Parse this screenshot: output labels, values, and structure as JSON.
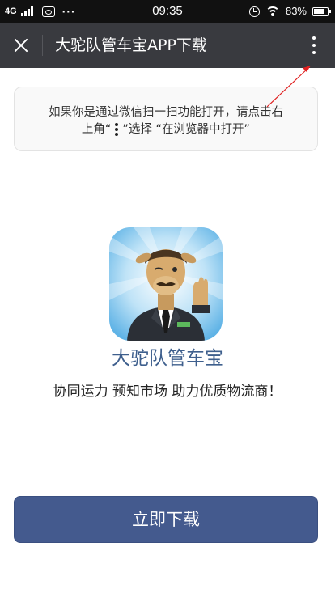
{
  "status_bar": {
    "network": "4G",
    "time": "09:35",
    "extra": "···",
    "battery": "83%"
  },
  "nav": {
    "title": "大驼队管车宝APP下载"
  },
  "hint": {
    "line1": "如果你是通过微信扫一扫功能打开，请点击右",
    "line2_prefix": "上角“",
    "line2_suffix": "”选择 “在浏览器中打开”"
  },
  "app": {
    "name": "大驼队管车宝",
    "tagline": "协同运力 预知市场 助力优质物流商！"
  },
  "download": {
    "label": "立即下载"
  },
  "colors": {
    "nav_bg": "#393a3f",
    "button_bg": "#445a8e",
    "app_name": "#3e5f8d",
    "arrow": "#e02020"
  }
}
